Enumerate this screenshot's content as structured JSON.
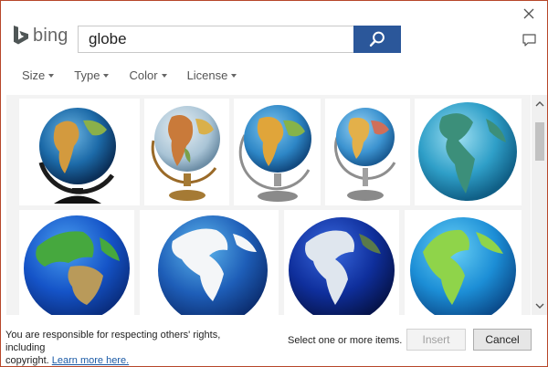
{
  "dialog": {
    "brand": "bing",
    "close_icon": "close-icon",
    "feedback_icon": "feedback-icon"
  },
  "search": {
    "value": "globe",
    "button_icon": "search-icon"
  },
  "filters": [
    {
      "label": "Size"
    },
    {
      "label": "Type"
    },
    {
      "label": "Color"
    },
    {
      "label": "License"
    }
  ],
  "results": [
    {
      "name": "globe-result-1",
      "subject": "globe on black stand",
      "row": 1
    },
    {
      "name": "globe-result-2",
      "subject": "antique globe on wooden stand",
      "row": 1
    },
    {
      "name": "globe-result-3",
      "subject": "globe on silver stand",
      "row": 1
    },
    {
      "name": "globe-result-4",
      "subject": "small globe on silver stand",
      "row": 1
    },
    {
      "name": "globe-result-5",
      "subject": "earth globe americas",
      "row": 1
    },
    {
      "name": "globe-result-6",
      "subject": "green blue earth europe africa",
      "row": 2
    },
    {
      "name": "globe-result-7",
      "subject": "blue white earth americas",
      "row": 2
    },
    {
      "name": "globe-result-8",
      "subject": "dark blue earth americas",
      "row": 2
    },
    {
      "name": "globe-result-9",
      "subject": "green blue earth americas",
      "row": 2
    }
  ],
  "colors": {
    "accent": "#2b579a",
    "border": "#b7472a",
    "link": "#1a5aa6"
  },
  "footer": {
    "disclaimer_line1": "You are responsible for respecting others' rights, including",
    "disclaimer_line2": "copyright.",
    "learn_more": "Learn more here.",
    "status": "Select one or more items.",
    "insert_label": "Insert",
    "cancel_label": "Cancel"
  }
}
